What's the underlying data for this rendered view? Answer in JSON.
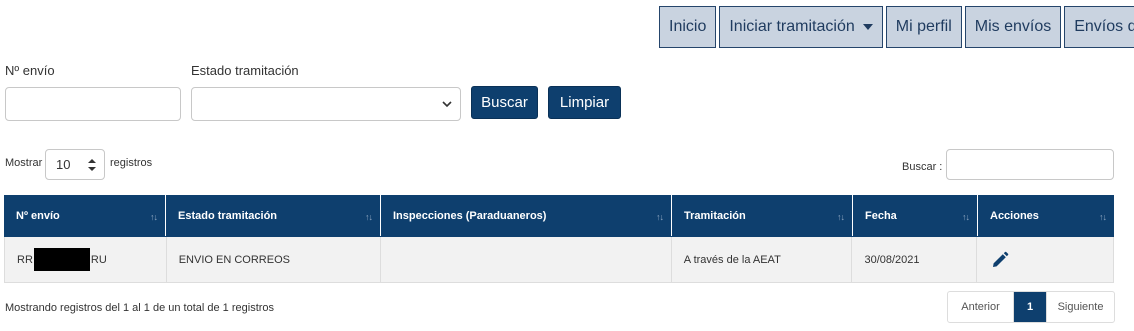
{
  "nav": {
    "items": [
      {
        "label": "Inicio"
      },
      {
        "label": "Iniciar tramitación",
        "dropdown": true
      },
      {
        "label": "Mi perfil"
      },
      {
        "label": "Mis envíos"
      },
      {
        "label": "Envíos de"
      }
    ]
  },
  "filters": {
    "envio_label": "Nº envío",
    "envio_value": "",
    "estado_label": "Estado tramitación",
    "estado_value": "",
    "search_button": "Buscar",
    "clear_button": "Limpiar"
  },
  "table_controls": {
    "show_prefix": "Mostrar",
    "page_length": "10",
    "show_suffix": "registros",
    "search_label": "Buscar :",
    "search_value": ""
  },
  "table": {
    "columns": [
      "Nº envío",
      "Estado tramitación",
      "Inspecciones (Paraduaneros)",
      "Tramitación",
      "Fecha",
      "Acciones"
    ],
    "rows": [
      {
        "envio_prefix": "RR",
        "envio_suffix": "RU",
        "estado": "ENVIO EN CORREOS",
        "inspecciones": "",
        "tramitacion": "A través de la AEAT",
        "fecha": "30/08/2021",
        "action_icon": "pencil-icon"
      }
    ]
  },
  "footer": {
    "info": "Mostrando registros del 1 al 1 de un total de 1 registros",
    "prev": "Anterior",
    "current": "1",
    "next": "Siguiente"
  },
  "colors": {
    "primary": "#0e3f6e",
    "nav_bg": "#c9d3e0",
    "row_bg": "#f2f2f2"
  }
}
